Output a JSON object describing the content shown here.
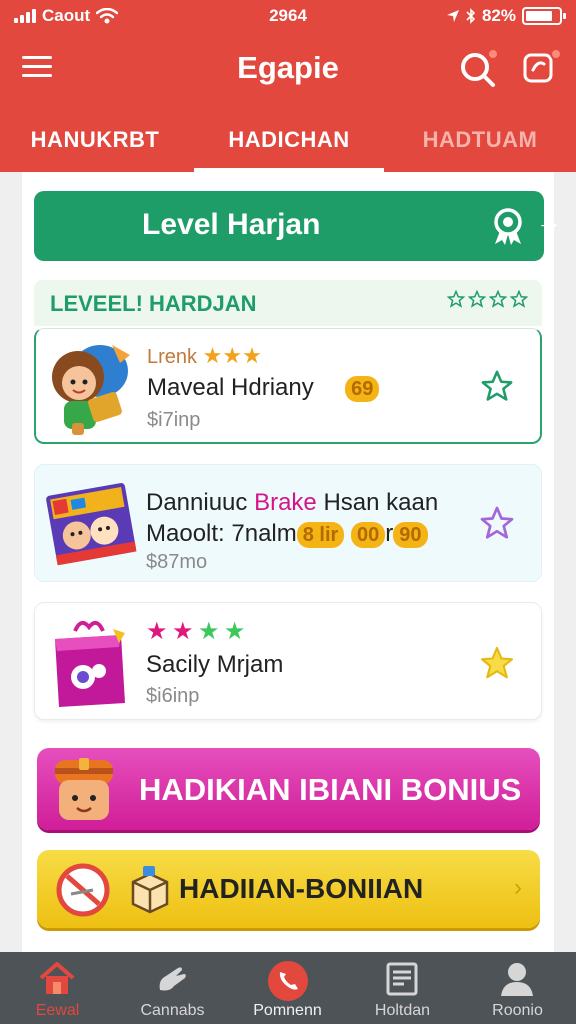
{
  "status_bar": {
    "carrier": "Caout",
    "time": "2964",
    "battery_text": "82%",
    "battery_level": 0.82
  },
  "app": {
    "title": "Egapie"
  },
  "tabs": [
    {
      "label": "HANUKRBT",
      "active": false
    },
    {
      "label": "HADICHAN",
      "active": true
    },
    {
      "label": "HADTUAM",
      "active": false
    }
  ],
  "level_banner": {
    "label": "Level Harjan",
    "icon": "ribbon-icon",
    "arrow": "→"
  },
  "section": {
    "title": "LEVEEL! HARDJAN",
    "rating_stars": 4
  },
  "items": [
    {
      "subtitle": "Lrenk",
      "subtitle_stars": 3,
      "name": "Maveal Hdriany",
      "coin": "69",
      "price": "$i7inp",
      "thumb": "girl-character-icon",
      "fav": "star-outline-icon"
    },
    {
      "title_part1": "Danniuuc ",
      "title_accent": "Brake",
      "title_part2": " Hsan kaan",
      "name_part": "Maoolt: 7nalm",
      "coin_a": "8 lir",
      "coin_b": "00",
      "name_tail": "r",
      "coin_c": "90",
      "price": "$87mo",
      "thumb": "game-box-icon",
      "fav": "star-outline-icon"
    },
    {
      "stars_colors": [
        "#e0187e",
        "#e0187e",
        "#3cc85a",
        "#3cc85a"
      ],
      "name": "Sacily Mrjam",
      "price": "$i6inp",
      "thumb": "gift-bag-icon",
      "fav": "star-filled-icon"
    }
  ],
  "bonus_pink": {
    "label": "HADIKIAN IBIANI BONIUS",
    "icon": "chest-face-icon"
  },
  "bonus_yellow": {
    "label": "HADIIAN-BONIIAN",
    "icon": "no-sign-icon",
    "icon2": "box-icon",
    "chevron": "›"
  },
  "bottom_nav": [
    {
      "label": "Eewal",
      "icon": "home-icon",
      "active": true
    },
    {
      "label": "Cannabs",
      "icon": "hand-icon",
      "active": false
    },
    {
      "label": "Pomnenn",
      "icon": "phone-icon",
      "active": false
    },
    {
      "label": "Holtdan",
      "icon": "document-icon",
      "active": false
    },
    {
      "label": "Roonio",
      "icon": "profile-icon",
      "active": false
    }
  ],
  "colors": {
    "header": "#e2483d",
    "green": "#1f9d69",
    "pink": "#d01e98",
    "yellow": "#eec012",
    "nav": "#4e5358"
  }
}
